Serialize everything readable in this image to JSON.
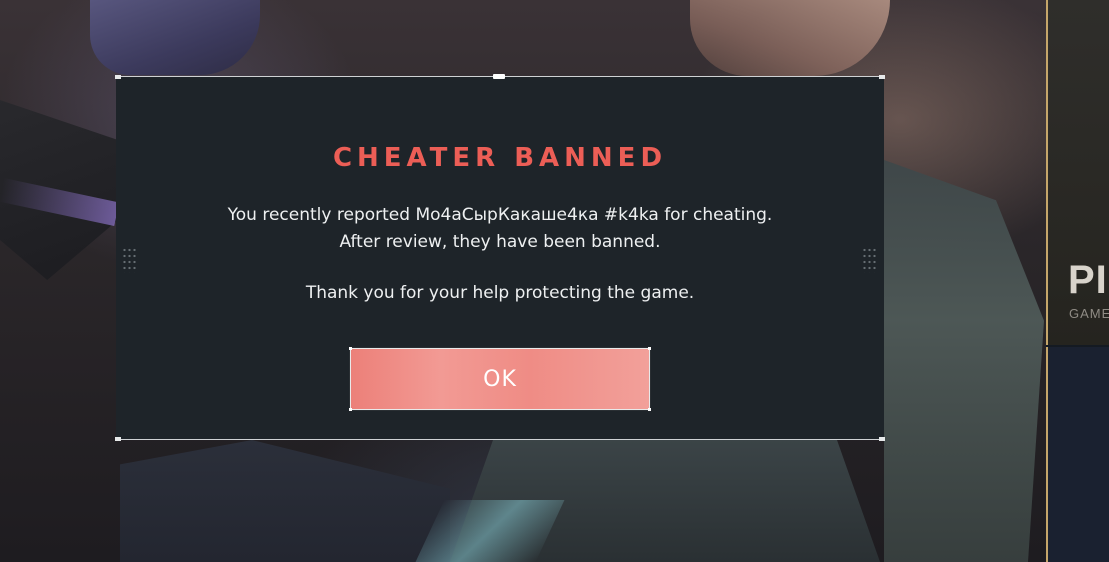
{
  "modal": {
    "title": "CHEATER BANNED",
    "message_line1": "You recently reported Mo4aСырКакаше4ка #k4ka for cheating.",
    "message_line2": "After review, they have been banned.",
    "message_line3": "Thank you for your help protecting the game.",
    "ok_label": "OK"
  },
  "side_card": {
    "heading": "PIC",
    "subheading": "GAME"
  },
  "colors": {
    "title": "#ec5e56",
    "button": "#ef8c85",
    "modal_background": "#1e2429",
    "side_accent": "#c5a66a"
  }
}
